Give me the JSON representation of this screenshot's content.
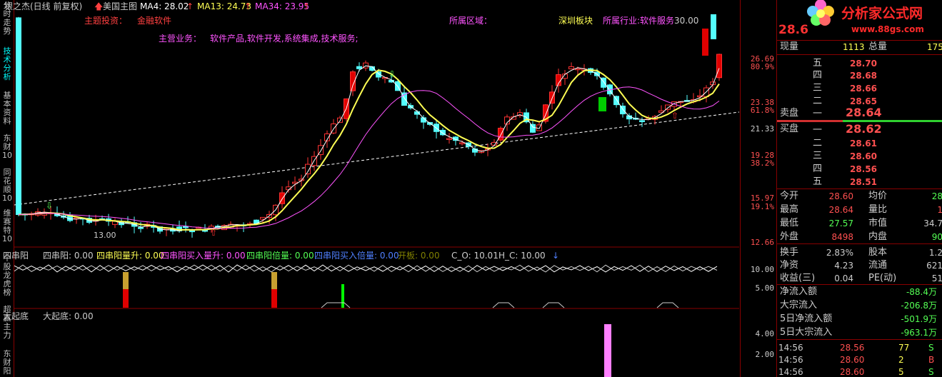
{
  "colors": {
    "up": "#ff3232",
    "down": "#54ffff",
    "ma4": "#ffffff",
    "ma13": "#ffff54",
    "ma34": "#ff54ff",
    "yellow": "#ffff00",
    "cyan": "#00ffff",
    "green": "#54ff54"
  },
  "left_tabs": [
    "分时走势",
    "技术分析",
    "基本资料",
    "东财10",
    "同花顺10",
    "维赛特10",
    "个股龙虎榜",
    "超赢主力",
    "东财阳"
  ],
  "header": {
    "stock": "银之杰(日线 前复权)",
    "arrow": "🡅",
    "tpl": "美国主图",
    "ma4": "MA4: 28.02",
    "ma13": "MA13: 24.73",
    "ma34": "MA34: 23.95",
    "up": "↑"
  },
  "info": {
    "main_invest": "主题投资：",
    "invest_val": "金融软件",
    "region": "所属区域：",
    "board": "深圳板块",
    "industry": "所属行业:软件服务",
    "biz": "主营业务：",
    "biz_val": "软件产品,软件开发,系统集成,技术服务;",
    "peak": "30.00"
  },
  "annotations": {
    "low_label": "13.00"
  },
  "price_axis": [
    {
      "v": "26.69",
      "c": "#ff5050"
    },
    {
      "v": "80.9%",
      "c": "#ff5050"
    },
    {
      "v": "23.38",
      "c": "#ff5050"
    },
    {
      "v": "61.8%",
      "c": "#ff5050"
    },
    {
      "v": "21.33",
      "c": "#ccc"
    },
    {
      "v": "19.28",
      "c": "#ff5050"
    },
    {
      "v": "38.2%",
      "c": "#ff5050"
    },
    {
      "v": "15.97",
      "c": "#ff5050"
    },
    {
      "v": "19.1%",
      "c": "#ff5050"
    },
    {
      "v": "12.66",
      "c": "#ff5050"
    }
  ],
  "ind1": {
    "name": "四串阳",
    "i0": "四串阳: 0.00",
    "i1": "四串阳量升: 0.00",
    "i2": "四串阳买入量升: 0.00",
    "i3": "四串阳倍量: 0.00",
    "i4": "四串阳买入倍量: 0.00",
    "i5": "开板: 0.00",
    "i6": "C_O: 10.01",
    "i7": "H_C: 10.00",
    "down": "↓",
    "axis": [
      "10.00",
      "5.00"
    ]
  },
  "ind2": {
    "name": "大起底",
    "i0": "大起底: 0.00",
    "axis": [
      "4.00",
      "2.00"
    ]
  },
  "logo": {
    "title": "分析家公式网",
    "url": "www.88gs.com"
  },
  "quote": {
    "price": "28.6"
  },
  "vol_row": {
    "l1": "现量",
    "v1": "1113",
    "l2": "总量",
    "v2": "175"
  },
  "asks": [
    {
      "l": "五",
      "p": "28.70"
    },
    {
      "l": "四",
      "p": "28.68"
    },
    {
      "l": "三",
      "p": "28.66"
    },
    {
      "l": "二",
      "p": "28.65"
    },
    {
      "l": "一",
      "p": "28.64"
    }
  ],
  "bids": [
    {
      "l": "一",
      "p": "28.62"
    },
    {
      "l": "二",
      "p": "28.61"
    },
    {
      "l": "三",
      "p": "28.60"
    },
    {
      "l": "四",
      "p": "28.56"
    },
    {
      "l": "五",
      "p": "28.51"
    }
  ],
  "sell_label": "卖盘",
  "buy_label": "买盘",
  "stats": [
    {
      "l1": "今开",
      "v1": "28.60",
      "c1": "#ff5050",
      "l2": "均价",
      "v2": "28",
      "c2": "#54ff54"
    },
    {
      "l1": "最高",
      "v1": "28.64",
      "c1": "#ff5050",
      "l2": "量比",
      "v2": "1",
      "c2": "#ff5050"
    },
    {
      "l1": "最低",
      "v1": "27.57",
      "c1": "#54ff54",
      "l2": "市值",
      "v2": "34.7",
      "c2": "#ccc"
    },
    {
      "l1": "外盘",
      "v1": "8498",
      "c1": "#ff5050",
      "l2": "内盘",
      "v2": "90",
      "c2": "#54ff54"
    },
    {
      "l1": "换手",
      "v1": "2.83%",
      "c1": "#ccc",
      "l2": "股本",
      "v2": "1.2",
      "c2": "#ccc"
    },
    {
      "l1": "净资",
      "v1": "4.23",
      "c1": "#ccc",
      "l2": "流通",
      "v2": "621",
      "c2": "#ccc"
    },
    {
      "l1": "收益(三)",
      "v1": "0.04",
      "c1": "#ccc",
      "l2": "PE(动)",
      "v2": "51",
      "c2": "#ccc"
    }
  ],
  "flows": [
    {
      "l": "净流入额",
      "v": "-88.4万"
    },
    {
      "l": "大宗流入",
      "v": "-206.8万"
    },
    {
      "l": "5日净流入额",
      "v": "-501.9万"
    },
    {
      "l": "5日大宗流入",
      "v": "-963.1万"
    }
  ],
  "ticks": [
    {
      "t": "14:56",
      "p": "28.56",
      "q": "77",
      "s": "S"
    },
    {
      "t": "14:56",
      "p": "28.60",
      "q": "2",
      "s": "B"
    },
    {
      "t": "14:56",
      "p": "28.60",
      "q": "5",
      "s": "S"
    }
  ]
}
